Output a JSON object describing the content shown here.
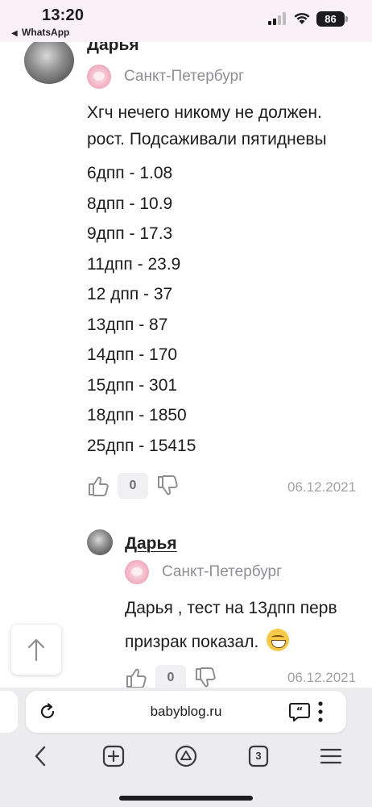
{
  "status_bar": {
    "time": "13:20",
    "back_app": "WhatsApp",
    "battery": "86"
  },
  "comment_1": {
    "author_partial": "Дарья",
    "city": "Санкт-Петербург",
    "text_lines": [
      "Хгч нечего никому не должен.",
      "рост. Подсаживали пятидневы"
    ],
    "values": [
      "6дпп - 1.08",
      "8дпп - 10.9",
      "9дпп - 17.3",
      "11дпп - 23.9",
      "12 дпп - 37",
      "13дпп - 87",
      "14дпп - 170",
      "15дпп - 301",
      "18дпп - 1850",
      "25дпп - 15415"
    ],
    "likes_count": "0",
    "date": "06.12.2021"
  },
  "comment_2": {
    "author": "Дарья",
    "city": "Санкт-Петербург",
    "text_line_1": "Дарья , тест на 13дпп перв",
    "text_line_2": "призрак показал.",
    "likes_count": "0",
    "date": "06.12.2021"
  },
  "browser": {
    "url": "babyblog.ru",
    "tabs_count": "3"
  },
  "icons": {
    "scroll_top": "arrow-up-icon",
    "reload": "reload-icon",
    "reader": "quote-bubble-icon",
    "more": "more-vertical-icon",
    "back": "chevron-left-icon",
    "new_tab": "plus-square-icon",
    "home": "home-triangle-icon",
    "tabs": "tabs-icon",
    "menu": "hamburger-icon"
  }
}
